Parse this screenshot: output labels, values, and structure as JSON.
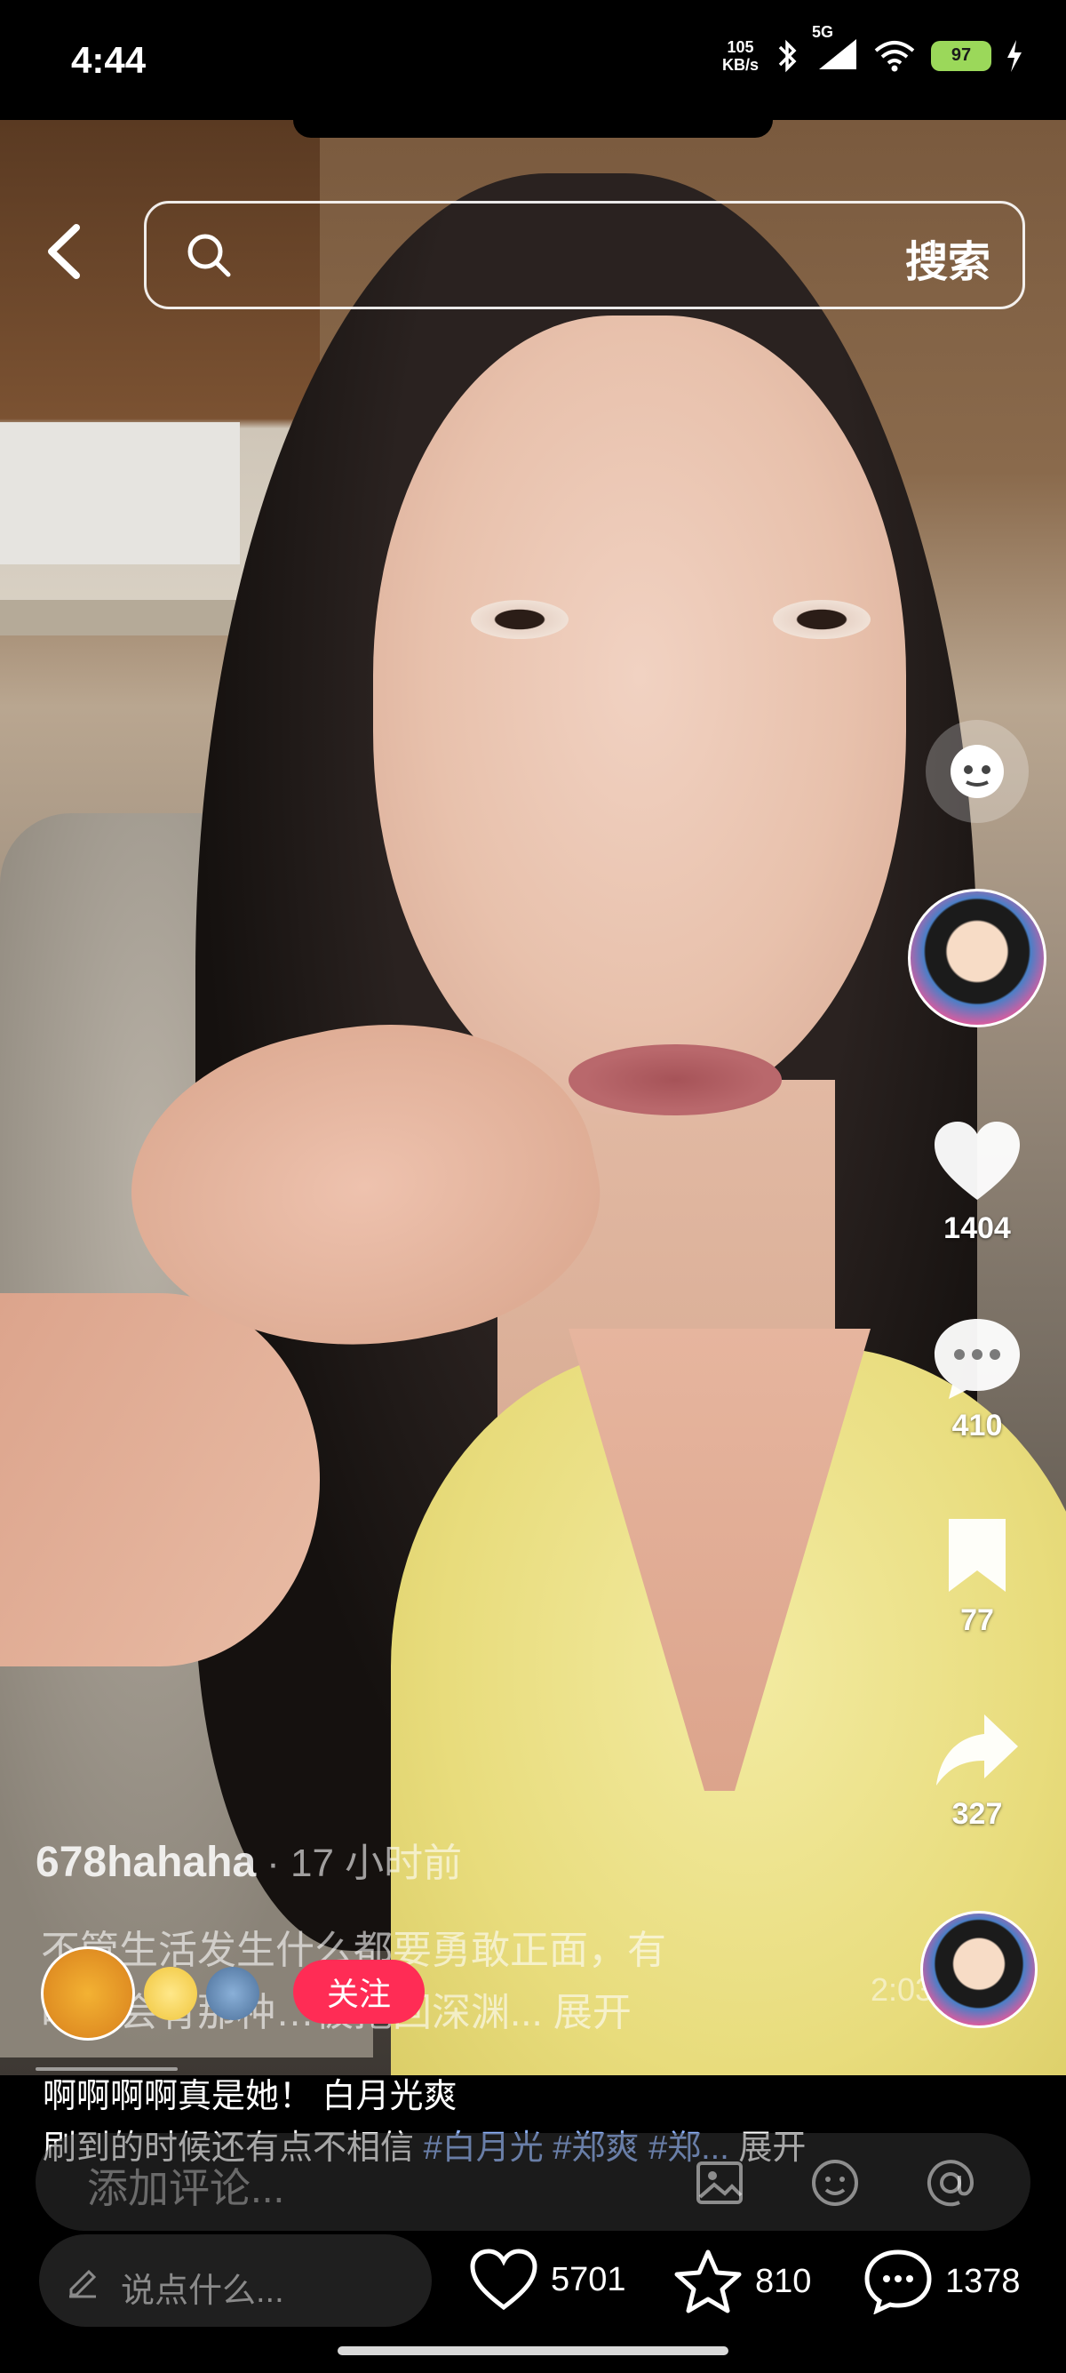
{
  "status_bar": {
    "time": "4:44",
    "net_speed_value": "105",
    "net_speed_unit": "KB/s",
    "network": "5G",
    "wifi_label": "6",
    "battery_text": "97",
    "icons": [
      "bluetooth-icon",
      "signal-icon",
      "wifi-icon",
      "battery-icon",
      "charging-icon"
    ]
  },
  "header": {
    "search_button": "搜索",
    "ghost_text": "‹"
  },
  "right_rail": {
    "likes": "1404",
    "comments": "410",
    "favorites": "77",
    "shares": "327"
  },
  "video_overlay": {
    "author": "678hahaha",
    "time_ago": "· 17 小时前",
    "description_line1": "不管生活发生什么都要勇敢正面，有",
    "description_line2": "时候会有那种…被拖回深渊... 展开",
    "follow_label": "关注",
    "timer": "2:03"
  },
  "caption": {
    "line1": "啊啊啊啊真是她！ 白月光爽",
    "line2_text": "刷到的时候还有点不相信 ",
    "tags": "#白月光 #郑爽 #郑...",
    "expand": " 展开"
  },
  "comment_bar": {
    "placeholder": "添加评论..."
  },
  "bottom_bar": {
    "say_placeholder": "说点什么...",
    "likes": "5701",
    "stars": "810",
    "comments": "1378"
  },
  "colors": {
    "follow_red": "#ff2c55",
    "tag_blue": "#8fb4ff",
    "battery_green": "#9bd85a"
  }
}
